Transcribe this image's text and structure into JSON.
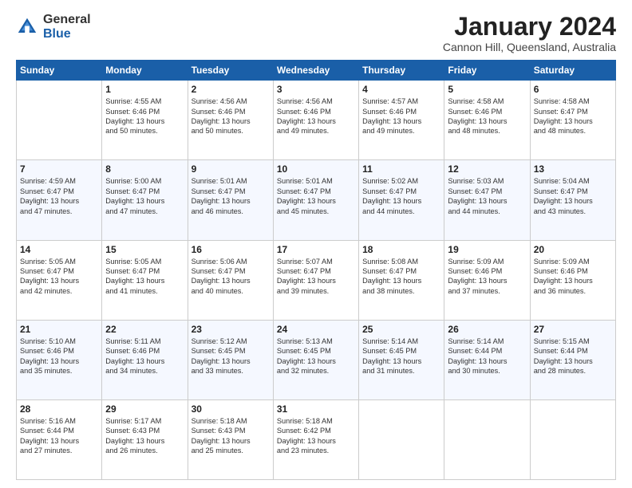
{
  "logo": {
    "general": "General",
    "blue": "Blue"
  },
  "title": "January 2024",
  "location": "Cannon Hill, Queensland, Australia",
  "days": [
    "Sunday",
    "Monday",
    "Tuesday",
    "Wednesday",
    "Thursday",
    "Friday",
    "Saturday"
  ],
  "weeks": [
    [
      {
        "num": "",
        "info": ""
      },
      {
        "num": "1",
        "info": "Sunrise: 4:55 AM\nSunset: 6:46 PM\nDaylight: 13 hours\nand 50 minutes."
      },
      {
        "num": "2",
        "info": "Sunrise: 4:56 AM\nSunset: 6:46 PM\nDaylight: 13 hours\nand 50 minutes."
      },
      {
        "num": "3",
        "info": "Sunrise: 4:56 AM\nSunset: 6:46 PM\nDaylight: 13 hours\nand 49 minutes."
      },
      {
        "num": "4",
        "info": "Sunrise: 4:57 AM\nSunset: 6:46 PM\nDaylight: 13 hours\nand 49 minutes."
      },
      {
        "num": "5",
        "info": "Sunrise: 4:58 AM\nSunset: 6:46 PM\nDaylight: 13 hours\nand 48 minutes."
      },
      {
        "num": "6",
        "info": "Sunrise: 4:58 AM\nSunset: 6:47 PM\nDaylight: 13 hours\nand 48 minutes."
      }
    ],
    [
      {
        "num": "7",
        "info": "Sunrise: 4:59 AM\nSunset: 6:47 PM\nDaylight: 13 hours\nand 47 minutes."
      },
      {
        "num": "8",
        "info": "Sunrise: 5:00 AM\nSunset: 6:47 PM\nDaylight: 13 hours\nand 47 minutes."
      },
      {
        "num": "9",
        "info": "Sunrise: 5:01 AM\nSunset: 6:47 PM\nDaylight: 13 hours\nand 46 minutes."
      },
      {
        "num": "10",
        "info": "Sunrise: 5:01 AM\nSunset: 6:47 PM\nDaylight: 13 hours\nand 45 minutes."
      },
      {
        "num": "11",
        "info": "Sunrise: 5:02 AM\nSunset: 6:47 PM\nDaylight: 13 hours\nand 44 minutes."
      },
      {
        "num": "12",
        "info": "Sunrise: 5:03 AM\nSunset: 6:47 PM\nDaylight: 13 hours\nand 44 minutes."
      },
      {
        "num": "13",
        "info": "Sunrise: 5:04 AM\nSunset: 6:47 PM\nDaylight: 13 hours\nand 43 minutes."
      }
    ],
    [
      {
        "num": "14",
        "info": "Sunrise: 5:05 AM\nSunset: 6:47 PM\nDaylight: 13 hours\nand 42 minutes."
      },
      {
        "num": "15",
        "info": "Sunrise: 5:05 AM\nSunset: 6:47 PM\nDaylight: 13 hours\nand 41 minutes."
      },
      {
        "num": "16",
        "info": "Sunrise: 5:06 AM\nSunset: 6:47 PM\nDaylight: 13 hours\nand 40 minutes."
      },
      {
        "num": "17",
        "info": "Sunrise: 5:07 AM\nSunset: 6:47 PM\nDaylight: 13 hours\nand 39 minutes."
      },
      {
        "num": "18",
        "info": "Sunrise: 5:08 AM\nSunset: 6:47 PM\nDaylight: 13 hours\nand 38 minutes."
      },
      {
        "num": "19",
        "info": "Sunrise: 5:09 AM\nSunset: 6:46 PM\nDaylight: 13 hours\nand 37 minutes."
      },
      {
        "num": "20",
        "info": "Sunrise: 5:09 AM\nSunset: 6:46 PM\nDaylight: 13 hours\nand 36 minutes."
      }
    ],
    [
      {
        "num": "21",
        "info": "Sunrise: 5:10 AM\nSunset: 6:46 PM\nDaylight: 13 hours\nand 35 minutes."
      },
      {
        "num": "22",
        "info": "Sunrise: 5:11 AM\nSunset: 6:46 PM\nDaylight: 13 hours\nand 34 minutes."
      },
      {
        "num": "23",
        "info": "Sunrise: 5:12 AM\nSunset: 6:45 PM\nDaylight: 13 hours\nand 33 minutes."
      },
      {
        "num": "24",
        "info": "Sunrise: 5:13 AM\nSunset: 6:45 PM\nDaylight: 13 hours\nand 32 minutes."
      },
      {
        "num": "25",
        "info": "Sunrise: 5:14 AM\nSunset: 6:45 PM\nDaylight: 13 hours\nand 31 minutes."
      },
      {
        "num": "26",
        "info": "Sunrise: 5:14 AM\nSunset: 6:44 PM\nDaylight: 13 hours\nand 30 minutes."
      },
      {
        "num": "27",
        "info": "Sunrise: 5:15 AM\nSunset: 6:44 PM\nDaylight: 13 hours\nand 28 minutes."
      }
    ],
    [
      {
        "num": "28",
        "info": "Sunrise: 5:16 AM\nSunset: 6:44 PM\nDaylight: 13 hours\nand 27 minutes."
      },
      {
        "num": "29",
        "info": "Sunrise: 5:17 AM\nSunset: 6:43 PM\nDaylight: 13 hours\nand 26 minutes."
      },
      {
        "num": "30",
        "info": "Sunrise: 5:18 AM\nSunset: 6:43 PM\nDaylight: 13 hours\nand 25 minutes."
      },
      {
        "num": "31",
        "info": "Sunrise: 5:18 AM\nSunset: 6:42 PM\nDaylight: 13 hours\nand 23 minutes."
      },
      {
        "num": "",
        "info": ""
      },
      {
        "num": "",
        "info": ""
      },
      {
        "num": "",
        "info": ""
      }
    ]
  ]
}
